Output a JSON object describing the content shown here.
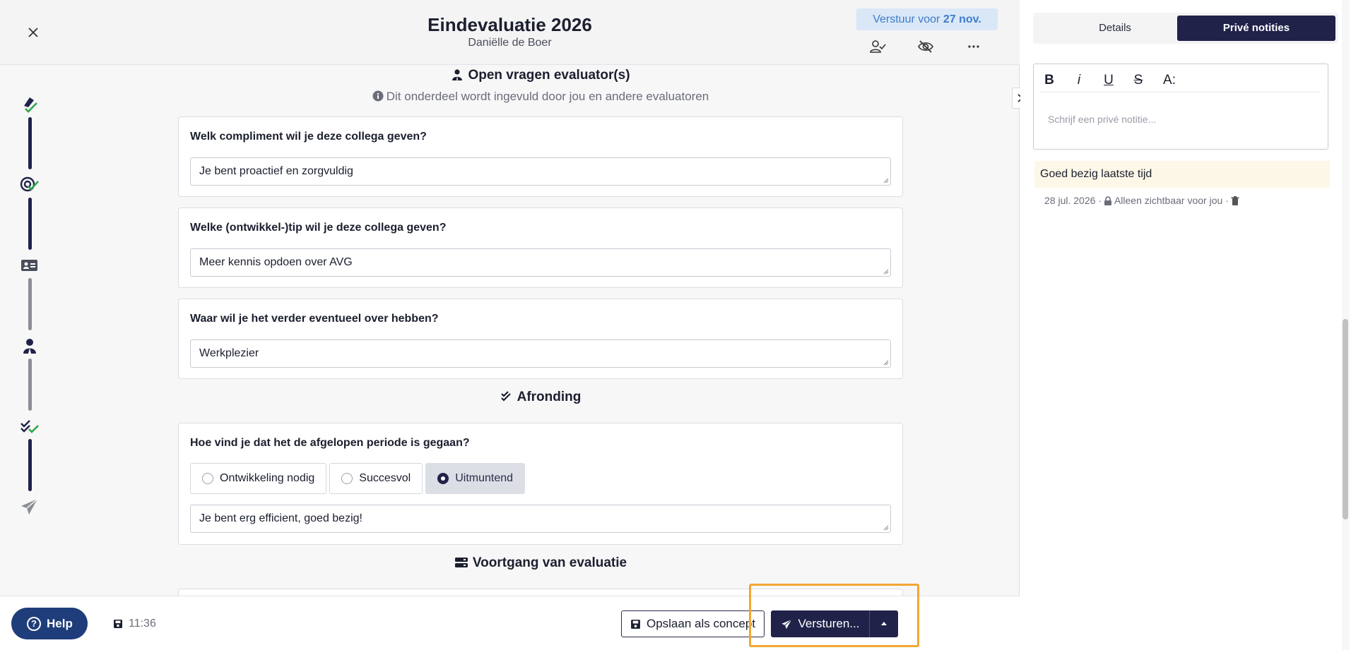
{
  "header": {
    "title": "Eindevaluatie 2026",
    "subtitle": "Daniëlle de Boer",
    "deadline_prefix": "Verstuur voor",
    "deadline_date": "27 nov.",
    "close_icon": "close-icon",
    "action_icons": [
      "assign-user-icon",
      "hide-icon",
      "more-icon"
    ]
  },
  "stepper": {
    "icons": [
      "rocket-check-icon",
      "target-check-icon",
      "id-card-icon",
      "person-icon",
      "double-check-icon",
      "send-icon"
    ]
  },
  "sections": {
    "open_questions": {
      "title": "Open vragen evaluator(s)",
      "info": "Dit onderdeel wordt ingevuld door jou en andere evaluatoren"
    },
    "afronding": {
      "title": "Afronding"
    },
    "voortgang": {
      "title": "Voortgang van evaluatie"
    }
  },
  "questions": [
    {
      "label": "Welk compliment wil je deze collega geven?",
      "answer": "Je bent proactief en zorgvuldig"
    },
    {
      "label": "Welke (ontwikkel-)tip wil je deze collega geven?",
      "answer": "Meer kennis opdoen over AVG"
    },
    {
      "label": "Waar wil je het verder eventueel over hebben?",
      "answer": "Werkplezier"
    }
  ],
  "rating_question": {
    "label": "Hoe vind je dat het de afgelopen periode is gegaan?",
    "options": [
      "Ontwikkeling nodig",
      "Succesvol",
      "Uitmuntend"
    ],
    "selected": "Uitmuntend",
    "comment": "Je bent erg efficient, goed bezig!"
  },
  "footer": {
    "help_label": "Help",
    "saved_time": "11:36",
    "save_concept_label": "Opslaan als concept",
    "send_label": "Versturen..."
  },
  "panel": {
    "tabs": [
      "Details",
      "Privé notities"
    ],
    "active_tab": "Privé notities",
    "editor_tools": [
      "B",
      "i",
      "U",
      "S",
      "A:"
    ],
    "editor_placeholder": "Schrijf een privé notitie...",
    "note": {
      "text": "Goed bezig laatste tijd",
      "date": "28 jul. 2026 ·",
      "visibility": "Alleen zichtbaar voor jou ·"
    }
  },
  "colors": {
    "primary": "#20224a",
    "accent_green": "#2ea84a",
    "deadline_bg": "#d9e7f7",
    "deadline_text": "#3f7cc9",
    "highlight": "#f3a731",
    "note_bg": "#fdf7e7"
  }
}
